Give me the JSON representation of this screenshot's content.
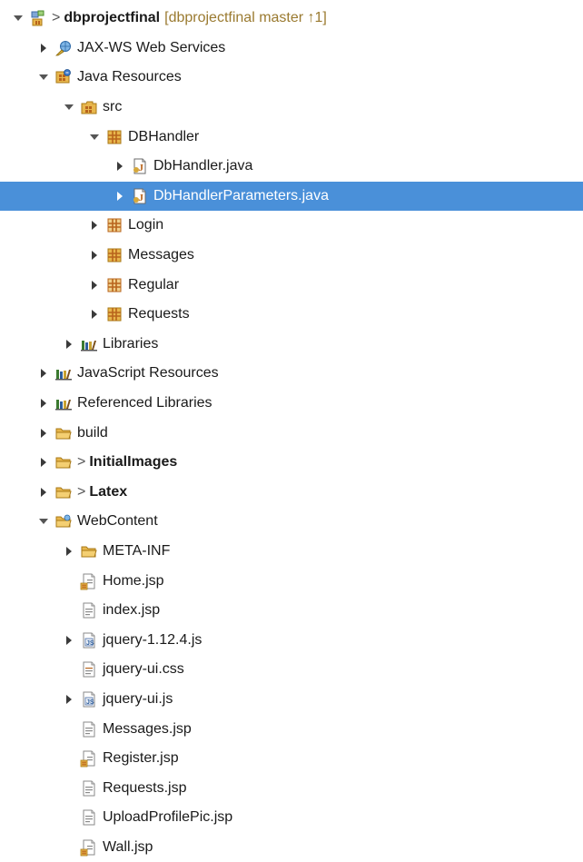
{
  "tree": {
    "rows": [
      {
        "level": 0,
        "twisty": "open",
        "icon": "project-icon",
        "dirty": ">",
        "label": "dbprojectfinal",
        "bold": true,
        "decoration": "[dbprojectfinal master ↑1]"
      },
      {
        "level": 1,
        "twisty": "closed",
        "icon": "web-services-icon",
        "label": "JAX-WS Web Services"
      },
      {
        "level": 1,
        "twisty": "open",
        "icon": "java-resources-icon",
        "label": "Java Resources"
      },
      {
        "level": 2,
        "twisty": "open",
        "icon": "source-folder-icon",
        "label": "src"
      },
      {
        "level": 3,
        "twisty": "open",
        "icon": "package-icon",
        "label": "DBHandler"
      },
      {
        "level": 4,
        "twisty": "closed",
        "icon": "java-file-icon",
        "label": "DbHandler.java"
      },
      {
        "level": 4,
        "twisty": "closed",
        "icon": "java-file-icon",
        "label": "DbHandlerParameters.java",
        "selected": true
      },
      {
        "level": 3,
        "twisty": "closed",
        "icon": "package-plain-icon",
        "label": "Login"
      },
      {
        "level": 3,
        "twisty": "closed",
        "icon": "package-icon",
        "label": "Messages"
      },
      {
        "level": 3,
        "twisty": "closed",
        "icon": "package-plain-icon",
        "label": "Regular"
      },
      {
        "level": 3,
        "twisty": "closed",
        "icon": "package-icon",
        "label": "Requests"
      },
      {
        "level": 2,
        "twisty": "closed",
        "icon": "libraries-icon",
        "label": "Libraries"
      },
      {
        "level": 1,
        "twisty": "closed",
        "icon": "libraries-icon",
        "label": "JavaScript Resources"
      },
      {
        "level": 1,
        "twisty": "closed",
        "icon": "libraries-icon",
        "label": "Referenced Libraries"
      },
      {
        "level": 1,
        "twisty": "closed",
        "icon": "folder-icon",
        "label": "build"
      },
      {
        "level": 1,
        "twisty": "closed",
        "icon": "folder-icon",
        "dirty": ">",
        "label": "InitialImages",
        "bold": true
      },
      {
        "level": 1,
        "twisty": "closed",
        "icon": "folder-icon",
        "dirty": ">",
        "label": "Latex",
        "bold": true
      },
      {
        "level": 1,
        "twisty": "open",
        "icon": "webcontent-folder-icon",
        "label": "WebContent"
      },
      {
        "level": 2,
        "twisty": "closed",
        "icon": "folder-icon",
        "label": "META-INF"
      },
      {
        "level": 2,
        "twisty": "none",
        "icon": "jsp-file-modified-icon",
        "label": "Home.jsp"
      },
      {
        "level": 2,
        "twisty": "none",
        "icon": "jsp-file-icon",
        "label": "index.jsp"
      },
      {
        "level": 2,
        "twisty": "closed",
        "icon": "js-file-icon",
        "label": "jquery-1.12.4.js"
      },
      {
        "level": 2,
        "twisty": "none",
        "icon": "css-file-icon",
        "label": "jquery-ui.css"
      },
      {
        "level": 2,
        "twisty": "closed",
        "icon": "js-file-icon",
        "label": "jquery-ui.js"
      },
      {
        "level": 2,
        "twisty": "none",
        "icon": "jsp-file-icon",
        "label": "Messages.jsp"
      },
      {
        "level": 2,
        "twisty": "none",
        "icon": "jsp-file-modified-icon",
        "label": "Register.jsp"
      },
      {
        "level": 2,
        "twisty": "none",
        "icon": "jsp-file-icon",
        "label": "Requests.jsp"
      },
      {
        "level": 2,
        "twisty": "none",
        "icon": "jsp-file-icon",
        "label": "UploadProfilePic.jsp"
      },
      {
        "level": 2,
        "twisty": "none",
        "icon": "jsp-file-modified-icon",
        "label": "Wall.jsp"
      }
    ]
  },
  "colors": {
    "selection": "#4a90d9",
    "decoration": "#9a7a30",
    "package": "#b8641c",
    "folder": "#e8b64c",
    "libraries": "#3b7a2f"
  }
}
